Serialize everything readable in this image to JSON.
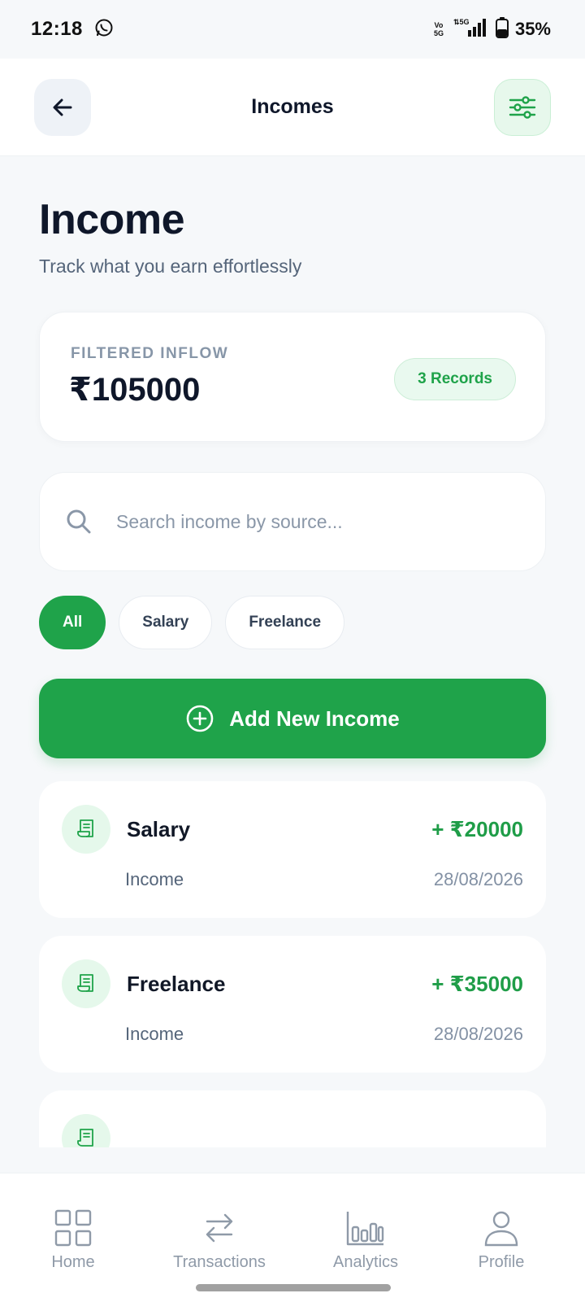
{
  "status_bar": {
    "time": "12:18",
    "volte": "Vo\n5G",
    "network": "5G",
    "battery": "35%"
  },
  "app_bar": {
    "title": "Incomes",
    "back_icon": "arrow-left-icon",
    "filter_icon": "sliders-icon"
  },
  "header": {
    "title": "Income",
    "subtitle": "Track what you earn effortlessly"
  },
  "summary": {
    "label": "FILTERED INFLOW",
    "amount": "₹105000",
    "records": "3 Records"
  },
  "search": {
    "placeholder": "Search income by source...",
    "value": ""
  },
  "filters": [
    {
      "label": "All",
      "active": true
    },
    {
      "label": "Salary",
      "active": false
    },
    {
      "label": "Freelance",
      "active": false
    }
  ],
  "add_button": {
    "label": "Add New Income"
  },
  "incomes": [
    {
      "name": "Salary",
      "amount": "+ ₹20000",
      "type": "Income",
      "date": "28/08/2026"
    },
    {
      "name": "Freelance",
      "amount": "+ ₹35000",
      "type": "Income",
      "date": "28/08/2026"
    },
    {
      "name": "",
      "amount": "",
      "type": "",
      "date": ""
    }
  ],
  "bottom_nav": [
    {
      "label": "Home",
      "icon": "grid-icon"
    },
    {
      "label": "Transactions",
      "icon": "swap-arrows-icon"
    },
    {
      "label": "Analytics",
      "icon": "bar-chart-icon"
    },
    {
      "label": "Profile",
      "icon": "user-icon"
    }
  ],
  "colors": {
    "accent": "#1fa34a",
    "income_amount": "#1f9d48",
    "background": "#f6f8fa"
  }
}
